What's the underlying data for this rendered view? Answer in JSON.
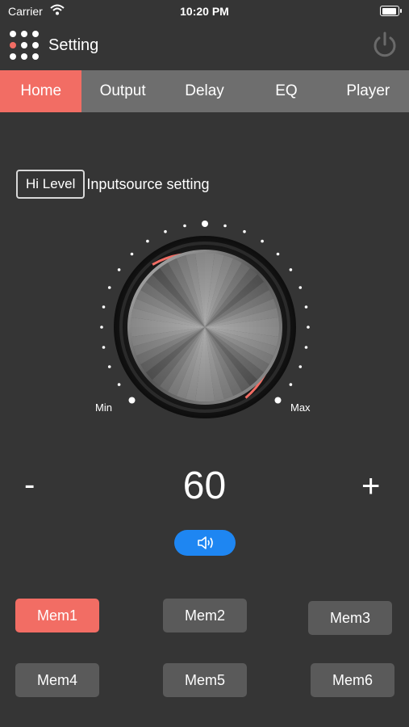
{
  "status_bar": {
    "carrier": "Carrier",
    "time": "10:20 PM"
  },
  "nav": {
    "title": "Setting",
    "menu_icon": "grid-icon",
    "power_icon": "power-icon"
  },
  "tabs": [
    {
      "label": "Home",
      "active": true
    },
    {
      "label": "Output",
      "active": false
    },
    {
      "label": "Delay",
      "active": false
    },
    {
      "label": "EQ",
      "active": false
    },
    {
      "label": "Player",
      "active": false
    }
  ],
  "input_source": {
    "button_label": "Hi Level",
    "label": "Inputsource setting"
  },
  "knob": {
    "min_label": "Min",
    "max_label": "Max",
    "accent_color": "#f26d64"
  },
  "volume": {
    "minus_label": "-",
    "plus_label": "+",
    "value": "60",
    "speaker_icon": "speaker-icon"
  },
  "memories": [
    {
      "label": "Mem1",
      "active": true
    },
    {
      "label": "Mem2",
      "active": false
    },
    {
      "label": "Mem3",
      "active": false
    },
    {
      "label": "Mem4",
      "active": false
    },
    {
      "label": "Mem5",
      "active": false
    },
    {
      "label": "Mem6",
      "active": false
    }
  ],
  "colors": {
    "background": "#353535",
    "accent": "#f26d64",
    "tab_bar": "#6e6e6e",
    "speaker_button": "#1e86f2"
  }
}
